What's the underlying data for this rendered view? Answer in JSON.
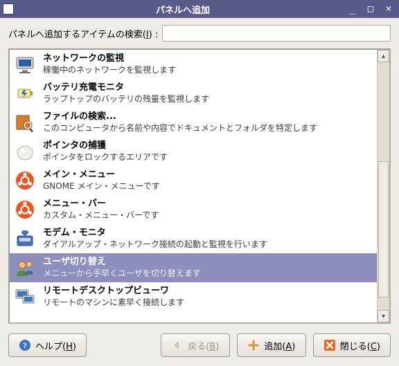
{
  "window": {
    "title": "パネルへ追加"
  },
  "search": {
    "label": "パネルへ追加するアイテムの検索(",
    "access_key": "I",
    "label_suffix": ") :",
    "value": ""
  },
  "items": [
    {
      "icon": "network-monitor",
      "title": "ネットワークの監視",
      "desc": "稼働中のネットワークを監視します",
      "selected": false
    },
    {
      "icon": "battery",
      "title": "バッテリ充電モニタ",
      "desc": "ラップトップのバッテリの残量を監視します",
      "selected": false
    },
    {
      "icon": "file-search",
      "title": "ファイルの検索...",
      "desc": "このコンピュータから名前や内容でドキュメントとフォルダを特定します",
      "selected": false
    },
    {
      "icon": "pointer-capture",
      "title": "ポインタの捕獲",
      "desc": "ポインタをロックするエリアです",
      "selected": false
    },
    {
      "icon": "ubuntu-logo",
      "title": "メイン・メニュー",
      "desc": "GNOME メイン・メニューです",
      "selected": false
    },
    {
      "icon": "ubuntu-logo",
      "title": "メニュー・バー",
      "desc": "カスタム・メニュー・バーです",
      "selected": false
    },
    {
      "icon": "modem",
      "title": "モデム・モニタ",
      "desc": "ダイアルアップ・ネットワーク接続の起動と監視を行います",
      "selected": false
    },
    {
      "icon": "user-switch",
      "title": "ユーザ切り替え",
      "desc": "メニューから手早くユーザを切り替えます",
      "selected": true
    },
    {
      "icon": "remote-desktop",
      "title": "リモートデスクトップビューワ",
      "desc": "リモートのマシンに素早く接続します",
      "selected": false
    }
  ],
  "buttons": {
    "help": {
      "label_pre": "ヘルプ(",
      "accel": "H",
      "label_post": ")"
    },
    "back": {
      "label_pre": "戻る(",
      "accel": "B",
      "label_post": ")",
      "disabled": true
    },
    "add": {
      "label_pre": "追加(",
      "accel": "A",
      "label_post": ")"
    },
    "close": {
      "label_pre": "閉じる(",
      "accel": "C",
      "label_post": ")"
    }
  }
}
